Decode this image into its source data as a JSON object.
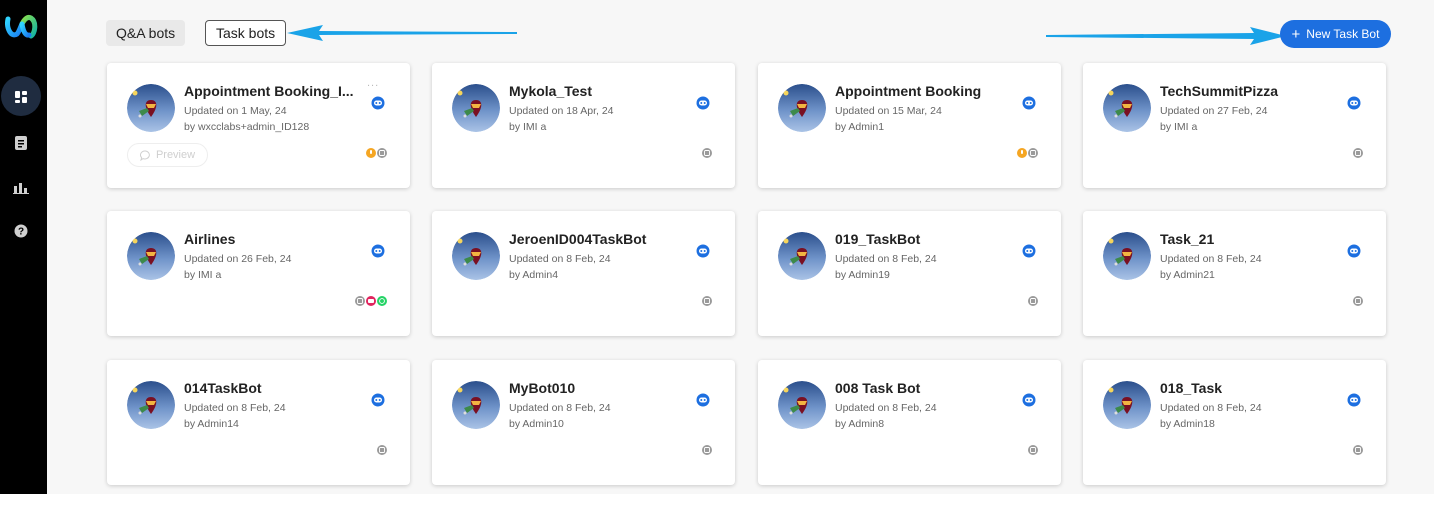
{
  "tabs": [
    {
      "label": "Q&A bots"
    },
    {
      "label": "Task bots"
    }
  ],
  "new_button": {
    "label": "New Task Bot"
  },
  "colors": {
    "accent": "#1d6fe0",
    "sidebar": "#000000",
    "arrow": "#1aa3e8"
  },
  "sidebar": {
    "items": [
      {
        "icon": "dashboard-icon"
      },
      {
        "icon": "document-icon"
      },
      {
        "icon": "bar-chart-icon"
      },
      {
        "icon": "help-icon"
      }
    ]
  },
  "first_card": {
    "more": "...",
    "preview_label": "Preview"
  },
  "bots": [
    {
      "name": "Appointment Booking_I...",
      "updated": "Updated on 1 May, 24",
      "by": "by wxcclabs+admin_ID128",
      "channels": [
        "voice",
        "web"
      ]
    },
    {
      "name": "Mykola_Test",
      "updated": "Updated on 18 Apr, 24",
      "by": "by IMI a",
      "channels": [
        "web"
      ]
    },
    {
      "name": "Appointment Booking",
      "updated": "Updated on 15 Mar, 24",
      "by": "by Admin1",
      "channels": [
        "voice",
        "web"
      ]
    },
    {
      "name": "TechSummitPizza",
      "updated": "Updated on 27 Feb, 24",
      "by": "by IMI a",
      "channels": [
        "web"
      ]
    },
    {
      "name": "Airlines",
      "updated": "Updated on 26 Feb, 24",
      "by": "by IMI a",
      "channels": [
        "web",
        "sms",
        "whatsapp"
      ]
    },
    {
      "name": "JeroenID004TaskBot",
      "updated": "Updated on 8 Feb, 24",
      "by": "by Admin4",
      "channels": [
        "web"
      ]
    },
    {
      "name": "019_TaskBot",
      "updated": "Updated on 8 Feb, 24",
      "by": "by Admin19",
      "channels": [
        "web"
      ]
    },
    {
      "name": "Task_21",
      "updated": "Updated on 8 Feb, 24",
      "by": "by Admin21",
      "channels": [
        "web"
      ]
    },
    {
      "name": "014TaskBot",
      "updated": "Updated on 8 Feb, 24",
      "by": "by Admin14",
      "channels": [
        "web"
      ]
    },
    {
      "name": "MyBot010",
      "updated": "Updated on 8 Feb, 24",
      "by": "by Admin10",
      "channels": [
        "web"
      ]
    },
    {
      "name": "008 Task Bot",
      "updated": "Updated on 8 Feb, 24",
      "by": "by Admin8",
      "channels": [
        "web"
      ]
    },
    {
      "name": "018_Task",
      "updated": "Updated on 8 Feb, 24",
      "by": "by Admin18",
      "channels": [
        "web"
      ]
    }
  ]
}
